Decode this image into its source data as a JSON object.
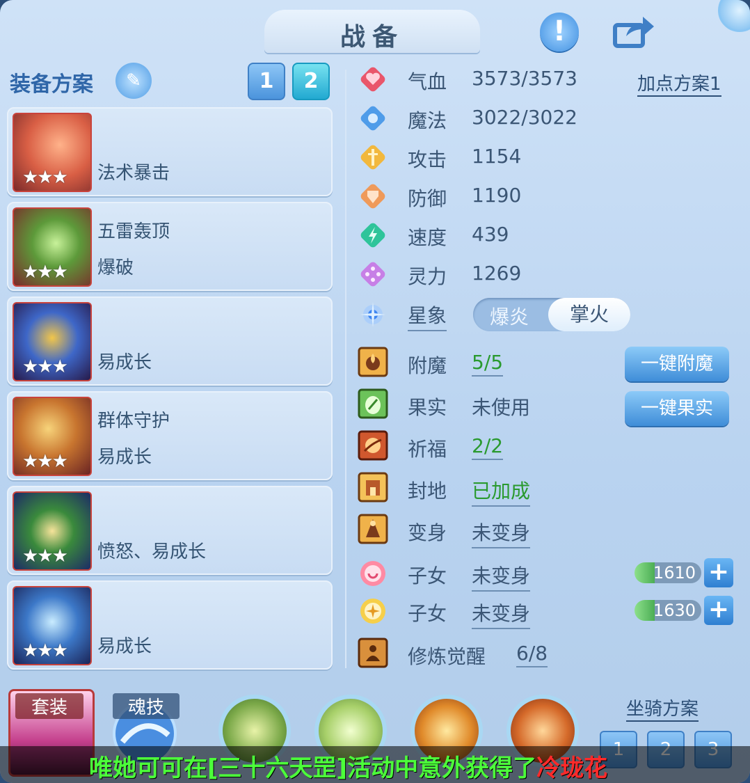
{
  "title": "战备",
  "left": {
    "scheme_label": "装备方案",
    "tabs": [
      "1",
      "2"
    ],
    "cards": [
      {
        "line1": "",
        "line2": "法术暴击",
        "stars": "★★★"
      },
      {
        "line1": "五雷轰顶",
        "line2": "爆破",
        "stars": "★★★"
      },
      {
        "line1": "",
        "line2": "易成长",
        "stars": "★★★"
      },
      {
        "line1": "群体守护",
        "line2": "易成长",
        "stars": "★★★"
      },
      {
        "line1": "",
        "line2": "愤怒、易成长",
        "stars": "★★★"
      },
      {
        "line1": "",
        "line2": "易成长",
        "stars": "★★★"
      }
    ]
  },
  "stats": {
    "plan_link": "加点方案1",
    "hp": {
      "name": "气血",
      "value": "3573/3573"
    },
    "mp": {
      "name": "魔法",
      "value": "3022/3022"
    },
    "atk": {
      "name": "攻击",
      "value": "1154"
    },
    "def": {
      "name": "防御",
      "value": "1190"
    },
    "spd": {
      "name": "速度",
      "value": "439"
    },
    "spirit": {
      "name": "灵力",
      "value": "1269"
    },
    "star": {
      "name": "星象",
      "opt_a": "爆炎",
      "opt_b": "掌火"
    }
  },
  "extras": {
    "enchant": {
      "name": "附魔",
      "value": "5/5",
      "button": "一键附魔"
    },
    "fruit": {
      "name": "果实",
      "value": "未使用",
      "button": "一键果实"
    },
    "pray": {
      "name": "祈福",
      "value": "2/2"
    },
    "seal": {
      "name": "封地",
      "value": "已加成"
    },
    "transform": {
      "name": "变身",
      "value": "未变身"
    },
    "child1": {
      "name": "子女",
      "value": "未变身",
      "bar": "1610"
    },
    "child2": {
      "name": "子女",
      "value": "未变身",
      "bar": "1630"
    },
    "awaken": {
      "name": "修炼觉醒",
      "value": "6/8"
    }
  },
  "bottom": {
    "suit": "套装",
    "soul": "魂技",
    "mount_label": "坐骑方案",
    "mount_tabs": [
      "1",
      "2",
      "3"
    ]
  },
  "banner": {
    "part1": "唯她可可在[三十六天罡]活动中意外获得了",
    "part2": "冷珑花"
  },
  "colors": {
    "accent_blue": "#2f66a8",
    "green_value": "#2a9a2f",
    "banner_green": "#4cff3a",
    "banner_red": "#ff2a2a"
  }
}
